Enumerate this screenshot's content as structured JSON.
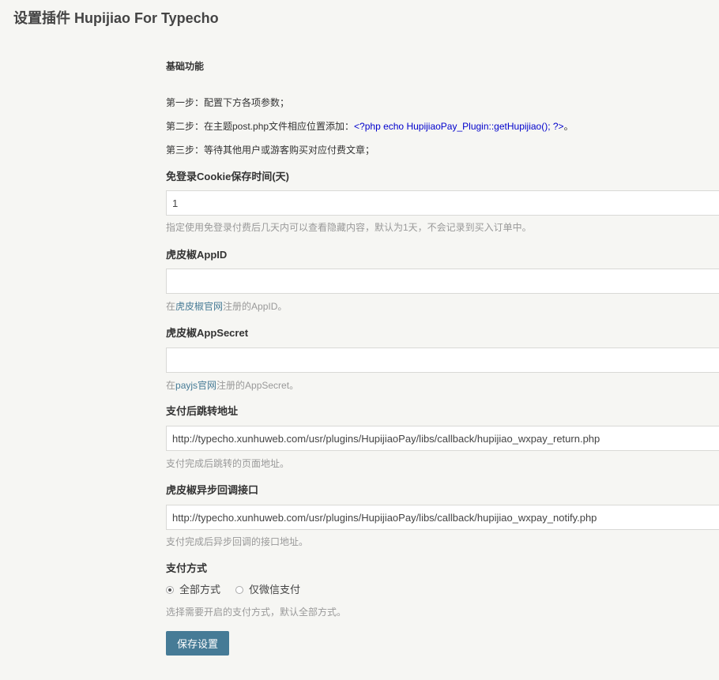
{
  "page": {
    "title": "设置插件 Hupijiao For Typecho"
  },
  "basic": {
    "section_title": "基础功能",
    "step1": "第一步：配置下方各项参数；",
    "step2_prefix": "第二步：在主题post.php文件相应位置添加：",
    "step2_code": "<?php echo HupijiaoPay_Plugin::getHupijiao(); ?>",
    "step2_suffix": "。",
    "step3": "第三步：等待其他用户或游客购买对应付费文章；"
  },
  "fields": {
    "cookie_days": {
      "label": "免登录Cookie保存时间(天)",
      "value": "1",
      "description": "指定使用免登录付费后几天内可以查看隐藏内容，默认为1天，不会记录到买入订单中。"
    },
    "appid": {
      "label": "虎皮椒AppID",
      "value": "",
      "desc_prefix": "在",
      "desc_link": "虎皮椒官网",
      "desc_suffix": "注册的AppID。"
    },
    "appsecret": {
      "label": "虎皮椒AppSecret",
      "value": "",
      "desc_prefix": "在",
      "desc_link": "payjs官网",
      "desc_suffix": "注册的AppSecret。"
    },
    "return_url": {
      "label": "支付后跳转地址",
      "value": "http://typecho.xunhuweb.com/usr/plugins/HupijiaoPay/libs/callback/hupijiao_wxpay_return.php",
      "description": "支付完成后跳转的页面地址。"
    },
    "notify_url": {
      "label": "虎皮椒异步回调接口",
      "value": "http://typecho.xunhuweb.com/usr/plugins/HupijiaoPay/libs/callback/hupijiao_wxpay_notify.php",
      "description": "支付完成后异步回调的接口地址。"
    },
    "pay_method": {
      "label": "支付方式",
      "options": [
        "全部方式",
        "仅微信支付"
      ],
      "selected": "全部方式",
      "description": "选择需要开启的支付方式，默认全部方式。"
    }
  },
  "actions": {
    "save_label": "保存设置"
  }
}
